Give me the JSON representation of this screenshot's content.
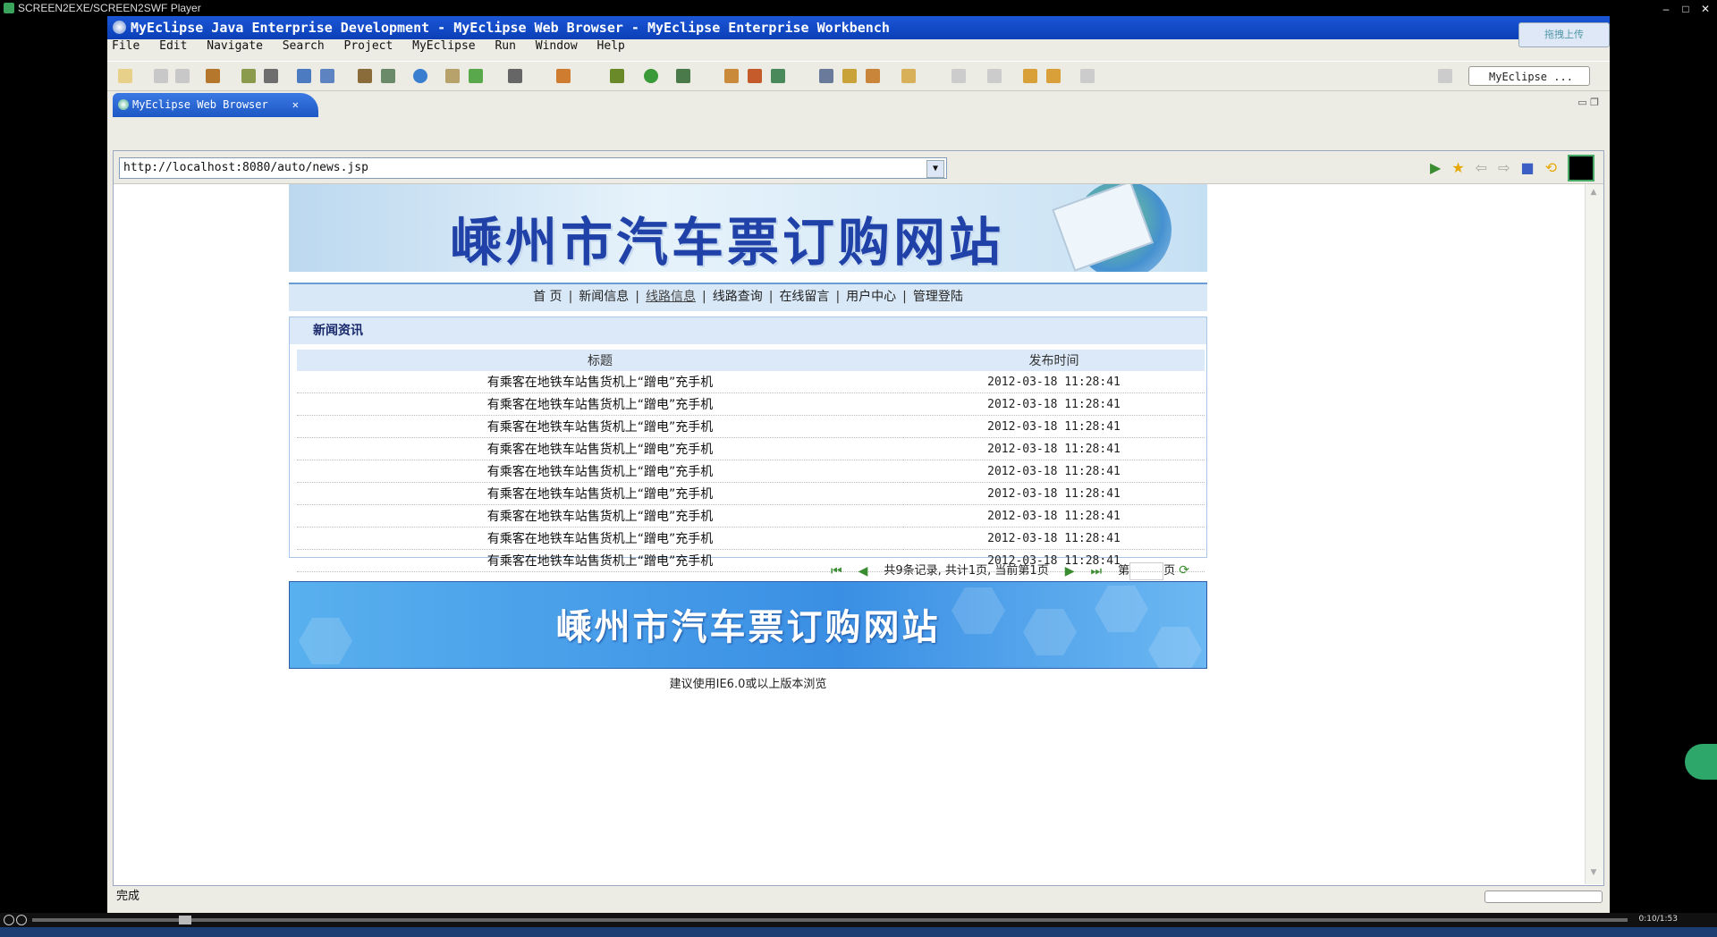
{
  "player": {
    "title": "SCREEN2EXE/SCREEN2SWF Player",
    "time": "0:10/1:53"
  },
  "ide": {
    "title": "MyEclipse Java Enterprise Development - MyEclipse Web Browser - MyEclipse Enterprise Workbench",
    "upload_label": "拖拽上传",
    "menu": [
      "File",
      "Edit",
      "Navigate",
      "Search",
      "Project",
      "MyEclipse",
      "Run",
      "Window",
      "Help"
    ],
    "perspective": "MyEclipse ...",
    "editor_tab": "MyEclipse Web Browser"
  },
  "browser": {
    "url": "http://localhost:8080/auto/news.jsp",
    "status": "完成"
  },
  "site": {
    "banner_title": "嵊州市汽车票订购网站",
    "nav": [
      "首 页",
      "新闻信息",
      "线路信息",
      "线路查询",
      "在线留言",
      "用户中心",
      "管理登陆"
    ],
    "section_title": "新闻资讯",
    "table": {
      "headers": [
        "标题",
        "发布时间"
      ],
      "rows": [
        {
          "title": "有乘客在地铁车站售货机上“蹭电”充手机",
          "time": "2012-03-18 11:28:41"
        },
        {
          "title": "有乘客在地铁车站售货机上“蹭电”充手机",
          "time": "2012-03-18 11:28:41"
        },
        {
          "title": "有乘客在地铁车站售货机上“蹭电”充手机",
          "time": "2012-03-18 11:28:41"
        },
        {
          "title": "有乘客在地铁车站售货机上“蹭电”充手机",
          "time": "2012-03-18 11:28:41"
        },
        {
          "title": "有乘客在地铁车站售货机上“蹭电”充手机",
          "time": "2012-03-18 11:28:41"
        },
        {
          "title": "有乘客在地铁车站售货机上“蹭电”充手机",
          "time": "2012-03-18 11:28:41"
        },
        {
          "title": "有乘客在地铁车站售货机上“蹭电”充手机",
          "time": "2012-03-18 11:28:41"
        },
        {
          "title": "有乘客在地铁车站售货机上“蹭电”充手机",
          "time": "2012-03-18 11:28:41"
        },
        {
          "title": "有乘客在地铁车站售货机上“蹭电”充手机",
          "time": "2012-03-18 11:28:41"
        }
      ]
    },
    "pager": {
      "summary": "共9条记录, 共计1页, 当前第1页",
      "page_prefix": "第",
      "page_suffix": "页"
    },
    "footer_title": "嵊州市汽车票订购网站",
    "footnote": "建议使用IE6.0或以上版本浏览"
  },
  "colors": {
    "ide_title": "#1b56d6",
    "nav_bg": "#d9e8f7",
    "footer_banner": "#3a8fe4"
  }
}
